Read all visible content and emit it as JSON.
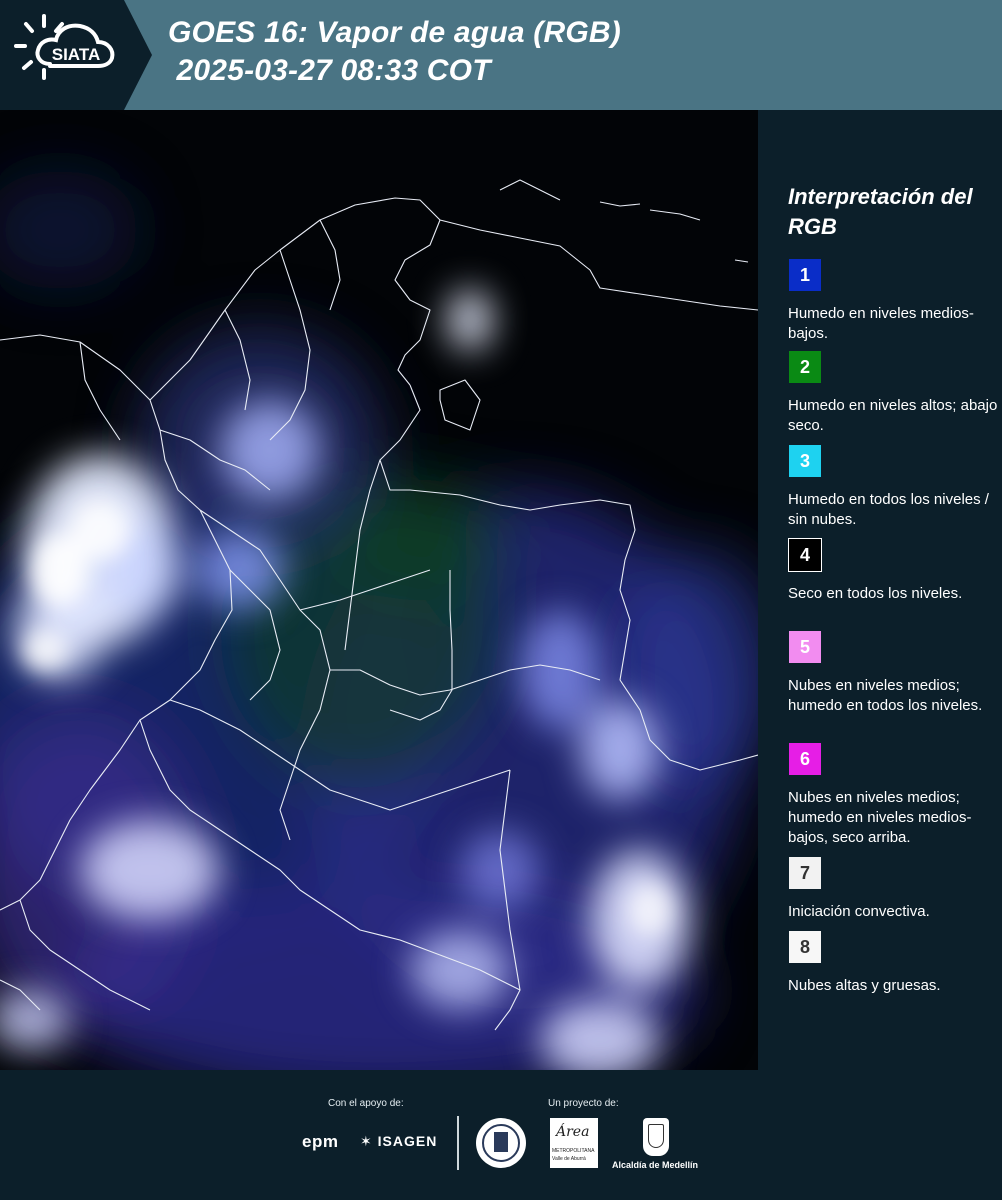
{
  "header": {
    "logo_text": "SIATA",
    "title_line1": "GOES 16: Vapor de agua (RGB)",
    "title_line2": " 2025-03-27 08:33 COT"
  },
  "legend": {
    "title": "Interpretación del RGB",
    "items": [
      {
        "number": "1",
        "color": "#0a2dc8",
        "text": "Humedo en niveles medios-bajos."
      },
      {
        "number": "2",
        "color": "#0a8a14",
        "text": "Humedo en niveles altos; abajo seco."
      },
      {
        "number": "3",
        "color": "#1ed2f0",
        "text": "Humedo en todos los niveles / sin nubes."
      },
      {
        "number": "4",
        "color": "#000000",
        "text": "Seco en todos los niveles."
      },
      {
        "number": "5",
        "color": "#f28cf0",
        "text": "Nubes en niveles medios; humedo en todos los niveles."
      },
      {
        "number": "6",
        "color": "#e61ee6",
        "text": "Nubes en niveles medios; humedo en niveles medios-bajos, seco arriba."
      },
      {
        "number": "7",
        "color": "#f2f2f2",
        "text": "Iniciación convectiva."
      },
      {
        "number": "8",
        "color": "#f7f7f7",
        "text": "Nubes altas y gruesas."
      }
    ]
  },
  "footer": {
    "support_label": "Con el apoyo de:",
    "project_label": "Un proyecto de:",
    "sponsor1": "epm",
    "sponsor2": "ISAGEN",
    "area_logo_title": "Área",
    "area_logo_sub": "METROPOLITANA",
    "area_logo_sub2": "Valle de Aburrá",
    "alcaldia": "Alcaldía de Medellín"
  }
}
